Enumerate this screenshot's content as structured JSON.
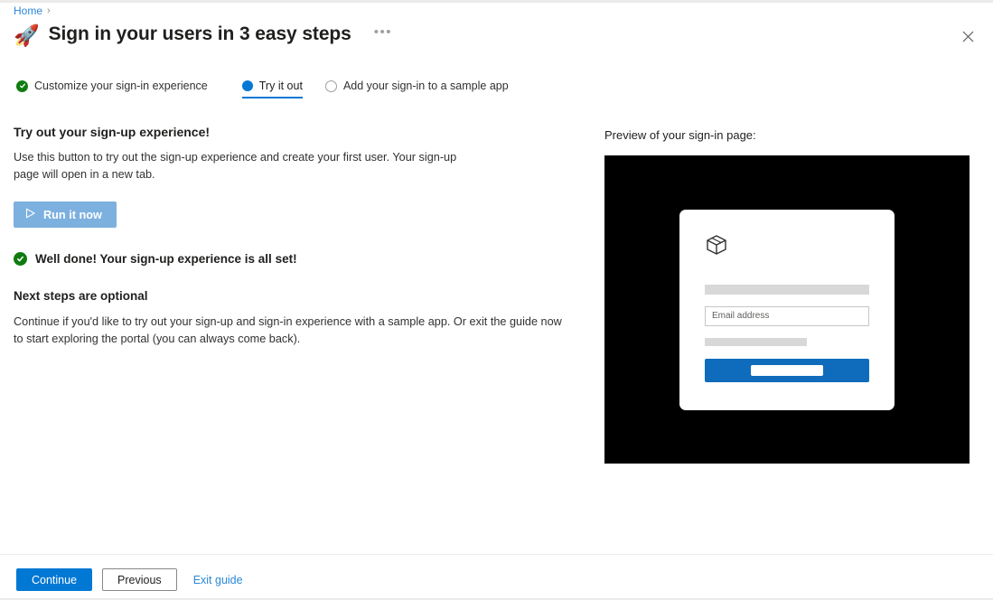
{
  "breadcrumb": {
    "home_label": "Home",
    "separator": "›"
  },
  "header": {
    "rocket_icon": "🚀",
    "title": "Sign in your users in 3 easy steps",
    "more_menu": "•••",
    "close_icon": "close-icon"
  },
  "steps": [
    {
      "label": "Customize your sign-in experience",
      "state": "completed"
    },
    {
      "label": "Try it out",
      "state": "active"
    },
    {
      "label": "Add your sign-in to a sample app",
      "state": "pending"
    }
  ],
  "main": {
    "section_heading": "Try out your sign-up experience!",
    "section_body": "Use this button to try out the sign-up experience and create your first user. Your sign-up page will open in a new tab.",
    "run_button_label": "Run it now",
    "run_button_icon": "play-icon",
    "success_message": "Well done! Your sign-up experience is all set!",
    "next_steps_heading": "Next steps are optional",
    "next_steps_body": "Continue if you'd like to try out your sign-up and sign-in experience with a sample app. Or exit the guide now to start exploring the portal (you can always come back)."
  },
  "preview": {
    "label": "Preview of your sign-in page:",
    "logo_icon": "cube-box-icon",
    "email_placeholder": "Email address"
  },
  "footer": {
    "continue_label": "Continue",
    "previous_label": "Previous",
    "exit_label": "Exit guide"
  },
  "colors": {
    "accent_blue": "#0078d4",
    "preview_button_blue": "#0f6cbd",
    "success_green": "#107c10",
    "run_button_blue": "#7cb0df",
    "link_blue": "#2b88d8"
  }
}
